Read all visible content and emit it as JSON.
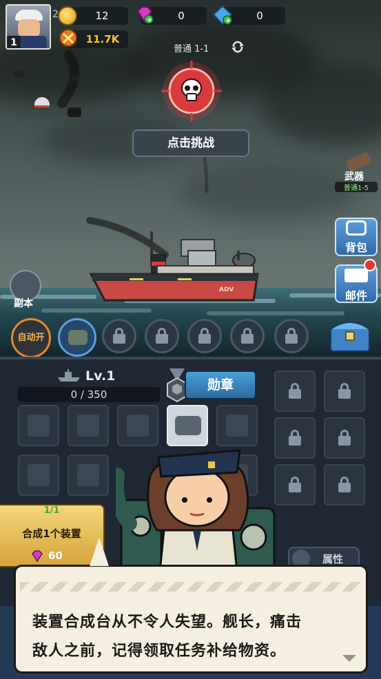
{
  "player": {
    "level": "1"
  },
  "resources": {
    "coins": "12",
    "gems_purple": "0",
    "gems_blue": "0",
    "power": "11.7K",
    "extra_digit": "2"
  },
  "stage": {
    "label": "普通 1-1",
    "challenge_button": "点击挑战"
  },
  "weapon": {
    "label": "武器",
    "stage": "普通1-5"
  },
  "side_buttons": {
    "bag": "背包",
    "mail": "邮件"
  },
  "dungeon": {
    "label": "副本"
  },
  "auto": {
    "label": "自动开"
  },
  "ship": {
    "hull_text": "ADV"
  },
  "panel": {
    "ship_level": "Lv.1",
    "exp": "0 / 350",
    "medal_button": "勋章",
    "synth": {
      "progress": "1/1",
      "label": "合成1个装置",
      "cost": "60"
    },
    "attributes": "属性"
  },
  "dialog": {
    "line1": "装置合成台从不令人失望。舰长，痛击",
    "line2": "敌人之前，记得领取任务补给物资。"
  },
  "colors": {
    "accent_gold": "#f5c22b",
    "stage_red": "#d93a3a",
    "panel_bg": "#1e2733",
    "side_blue": "#3f83c6",
    "dialog_bg": "#f4efe0"
  }
}
